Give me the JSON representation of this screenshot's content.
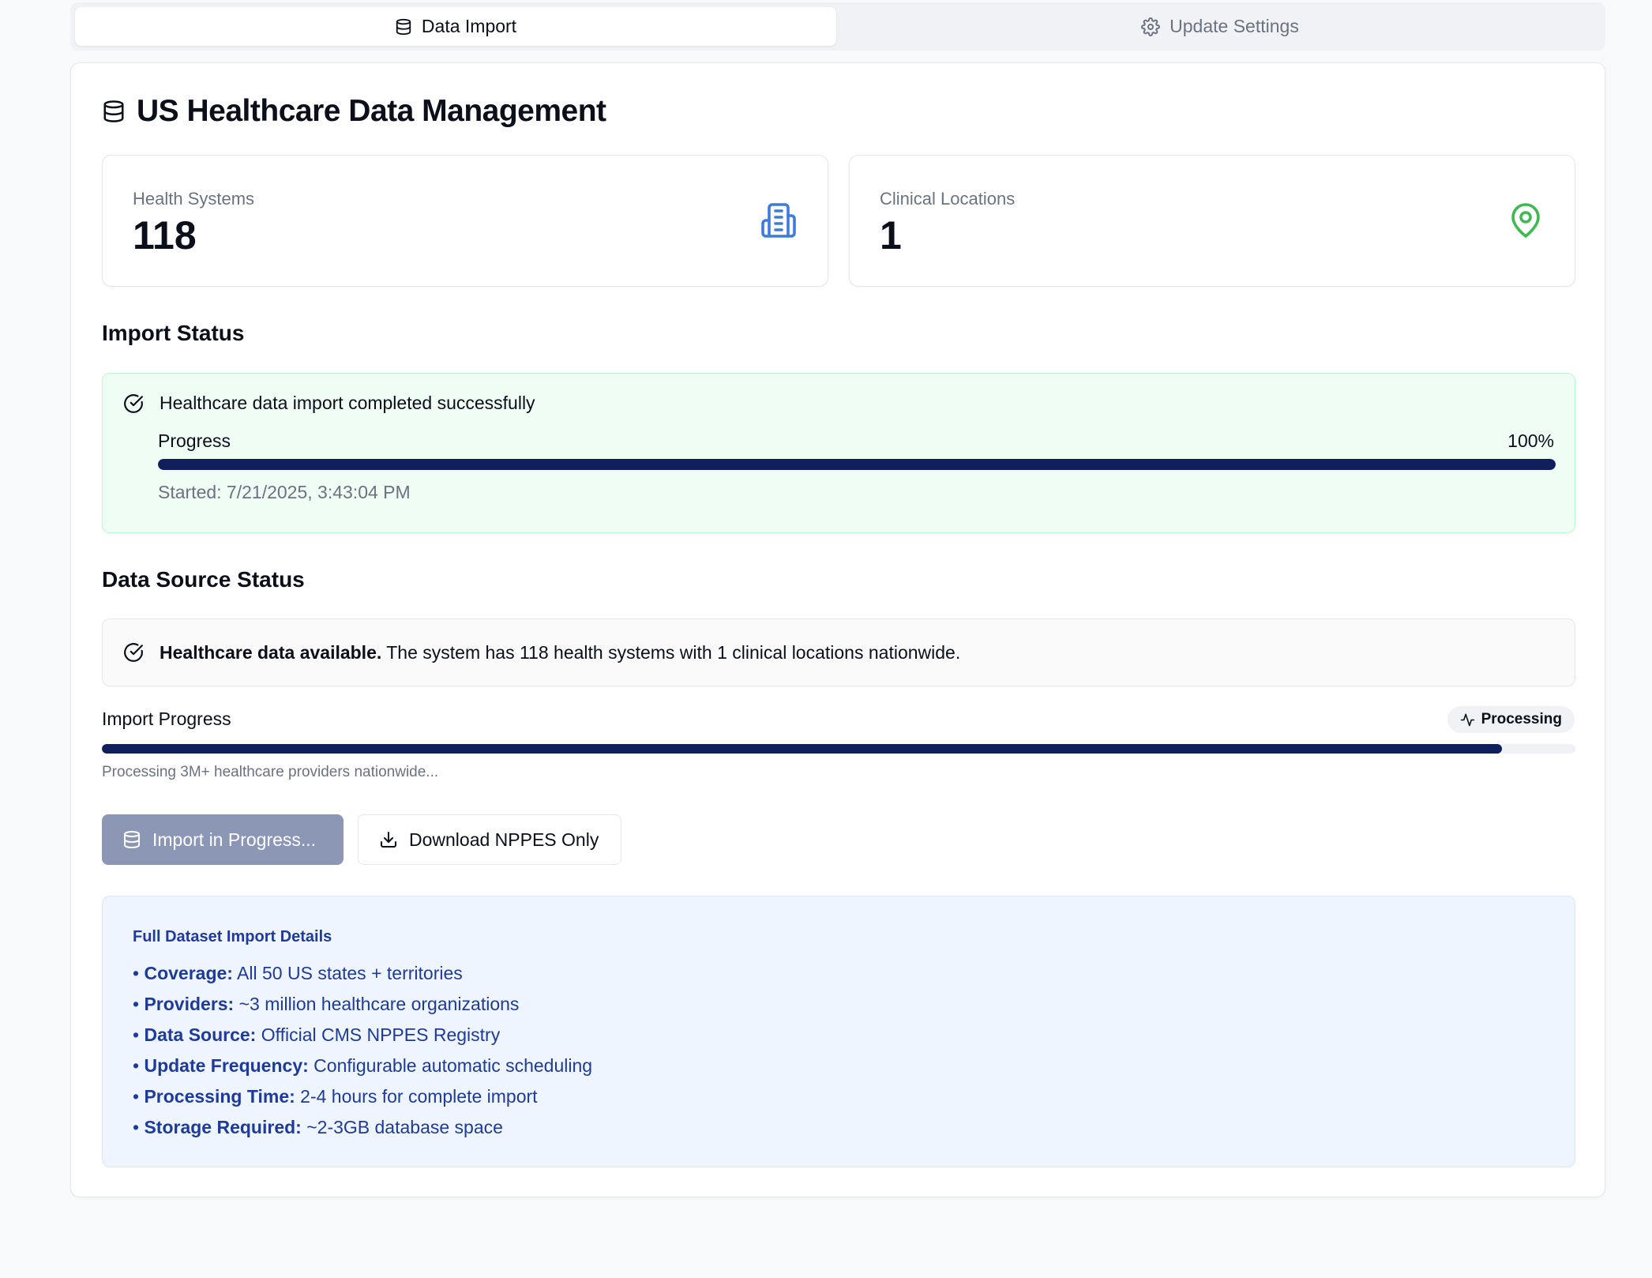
{
  "tabs": [
    {
      "label": "Data Import",
      "active": true,
      "icon": "database-icon"
    },
    {
      "label": "Update Settings",
      "active": false,
      "icon": "gear-icon"
    }
  ],
  "page": {
    "title": "US Healthcare Data Management",
    "icon": "database-icon"
  },
  "stats": [
    {
      "label": "Health Systems",
      "value": "118",
      "icon": "building-icon",
      "color": "#3b7ddd"
    },
    {
      "label": "Clinical Locations",
      "value": "1",
      "icon": "map-pin-icon",
      "color": "#3fb950"
    }
  ],
  "import_status": {
    "title": "Import Status",
    "message": "Healthcare data import completed successfully",
    "progress_label": "Progress",
    "progress_text": "100%",
    "progress_fraction": 1.0,
    "started": "Started: 7/21/2025, 3:43:04 PM"
  },
  "data_source": {
    "title": "Data Source Status",
    "bold": "Healthcare data available.",
    "text": " The system has 118 health systems with 1 clinical locations nationwide."
  },
  "import_progress": {
    "label": "Import Progress",
    "badge": "Processing",
    "progress_fraction": 0.95,
    "subtext": "Processing 3M+ healthcare providers nationwide..."
  },
  "buttons": {
    "import": "Import in Progress...",
    "download": "Download NPPES Only"
  },
  "details": {
    "title": "Full Dataset Import Details",
    "items": [
      {
        "key": "Coverage:",
        "value": " All 50 US states + territories"
      },
      {
        "key": "Providers:",
        "value": " ~3 million healthcare organizations"
      },
      {
        "key": "Data Source:",
        "value": " Official CMS NPPES Registry"
      },
      {
        "key": "Update Frequency:",
        "value": " Configurable automatic scheduling"
      },
      {
        "key": "Processing Time:",
        "value": " 2-4 hours for complete import"
      },
      {
        "key": "Storage Required:",
        "value": " ~2-3GB database space"
      }
    ]
  },
  "colors": {
    "accent": "#0f1f5c",
    "success_bg": "#f0fdf4",
    "info_text": "#1e3a9a"
  }
}
